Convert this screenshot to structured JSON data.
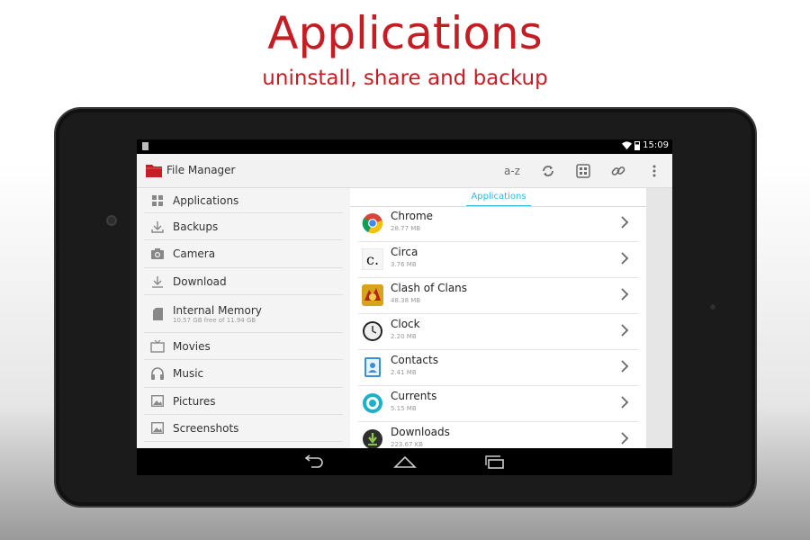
{
  "promo": {
    "title": "Applications",
    "subtitle": "uninstall, share and backup"
  },
  "statusbar": {
    "time": "15:09",
    "wifi_icon": "wifi-icon",
    "battery_icon": "battery-icon"
  },
  "actionbar": {
    "app_title": "File Manager",
    "sort_label": "a-z",
    "icons": [
      "refresh-icon",
      "grid-view-icon",
      "link-icon",
      "overflow-menu-icon"
    ]
  },
  "drawer": {
    "items": [
      {
        "label": "Applications",
        "icon": "grid-icon"
      },
      {
        "label": "Backups",
        "icon": "download-tray-icon"
      },
      {
        "label": "Camera",
        "icon": "camera-icon"
      },
      {
        "label": "Download",
        "icon": "download-icon"
      },
      {
        "label": "Internal Memory",
        "sublabel": "10.57 GB free of 11.94 GB",
        "icon": "sd-card-icon"
      },
      {
        "label": "Movies",
        "icon": "tv-icon"
      },
      {
        "label": "Music",
        "icon": "headphones-icon"
      },
      {
        "label": "Pictures",
        "icon": "picture-icon"
      },
      {
        "label": "Screenshots",
        "icon": "picture-icon"
      }
    ]
  },
  "panel": {
    "tab_label": "Applications",
    "apps": [
      {
        "name": "Chrome",
        "size": "28.77 MB",
        "icon": "chrome-icon"
      },
      {
        "name": "Circa",
        "size": "3.76 MB",
        "icon": "circa-icon"
      },
      {
        "name": "Clash of Clans",
        "size": "48.38 MB",
        "icon": "clash-of-clans-icon"
      },
      {
        "name": "Clock",
        "size": "2.20 MB",
        "icon": "clock-icon"
      },
      {
        "name": "Contacts",
        "size": "2.41 MB",
        "icon": "contacts-icon"
      },
      {
        "name": "Currents",
        "size": "5.15 MB",
        "icon": "currents-icon"
      },
      {
        "name": "Downloads",
        "size": "223.67 KB",
        "icon": "downloads-icon"
      }
    ]
  },
  "navbar": {
    "icons": [
      "back-icon",
      "home-icon",
      "recents-icon"
    ]
  },
  "colors": {
    "brand_red": "#c41d24",
    "accent_blue": "#33b5e5"
  }
}
